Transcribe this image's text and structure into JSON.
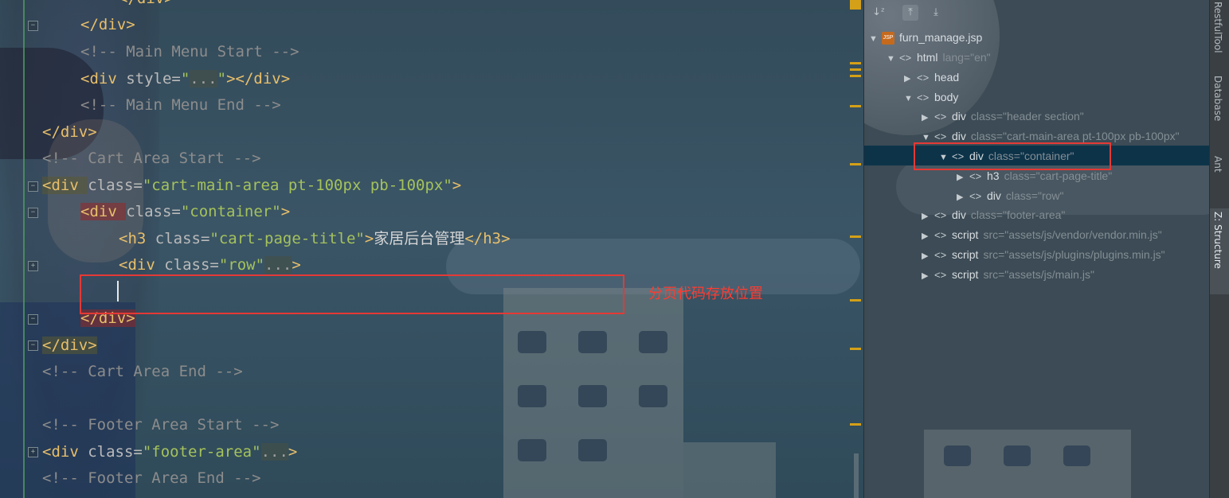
{
  "editor": {
    "lines": [
      {
        "indent": 2,
        "tag_open": "</div>"
      },
      {
        "indent": 1,
        "tag_open": "</div>"
      },
      {
        "indent": 1,
        "comment": "<!-- Main Menu Start -->"
      },
      {
        "indent": 1,
        "div_style": {
          "open": "<div ",
          "attr": "style=",
          "val": "\"",
          "fold": "...",
          "val_end": "\"",
          "close": "></div>"
        }
      },
      {
        "indent": 1,
        "comment": "<!-- Main Menu End -->"
      },
      {
        "indent": 0,
        "tag_open": "</div>"
      },
      {
        "indent": 0,
        "comment": "<!-- Cart Area Start -->"
      },
      {
        "indent": 0,
        "open": "<div ",
        "attr": "class=",
        "val": "\"cart-main-area pt-100px pb-100px\"",
        "close": ">"
      },
      {
        "indent": 1,
        "open": "<div ",
        "attr": "class=",
        "val": "\"container\"",
        "close": ">"
      },
      {
        "indent": 2,
        "open": "<h3 ",
        "attr": "class=",
        "val": "\"cart-page-title\"",
        "close": ">",
        "text": "家居后台管理",
        "end": "</h3>"
      },
      {
        "indent": 2,
        "open": "<div ",
        "attr": "class=",
        "val": "\"row\"",
        "fold": "...",
        "close": ">"
      },
      {
        "indent": 2,
        "caret": true
      },
      {
        "indent": 1,
        "tag_open": "</div>"
      },
      {
        "indent": 0,
        "tag_open": "</div>"
      },
      {
        "indent": 0,
        "comment": "<!-- Cart Area End -->"
      },
      {
        "indent": 0,
        "blank": true
      },
      {
        "indent": 0,
        "comment": "<!-- Footer Area Start -->"
      },
      {
        "indent": 0,
        "open": "<div ",
        "attr": "class=",
        "val": "\"footer-area\"",
        "fold": "...",
        "close": ">"
      },
      {
        "indent": 0,
        "comment": "<!-- Footer Area End -->"
      }
    ],
    "annotation": "分页代码存放位置"
  },
  "structure": {
    "file": "furn_manage.jsp",
    "file_badge": "JSP",
    "nodes": [
      {
        "label": "html",
        "attr": "lang=\"en\"",
        "level": 1,
        "expanded": true
      },
      {
        "label": "head",
        "attr": "",
        "level": 2,
        "expanded": false
      },
      {
        "label": "body",
        "attr": "",
        "level": 2,
        "expanded": true
      },
      {
        "label": "div",
        "attr": "class=\"header section\"",
        "level": 3,
        "expanded": false
      },
      {
        "label": "div",
        "attr": "class=\"cart-main-area pt-100px pb-100px\"",
        "level": 3,
        "expanded": true
      },
      {
        "label": "div",
        "attr": "class=\"container\"",
        "level": 4,
        "expanded": true,
        "selected": true
      },
      {
        "label": "h3",
        "attr": "class=\"cart-page-title\"",
        "level": 5,
        "expanded": false
      },
      {
        "label": "div",
        "attr": "class=\"row\"",
        "level": 5,
        "expanded": false
      },
      {
        "label": "div",
        "attr": "class=\"footer-area\"",
        "level": 3,
        "expanded": false
      },
      {
        "label": "script",
        "attr": "src=\"assets/js/vendor/vendor.min.js\"",
        "level": 3,
        "expanded": false
      },
      {
        "label": "script",
        "attr": "src=\"assets/js/plugins/plugins.min.js\"",
        "level": 3,
        "expanded": false
      },
      {
        "label": "script",
        "attr": "src=\"assets/js/main.js\"",
        "level": 3,
        "expanded": false
      }
    ],
    "toolbar": {
      "sort_icon": "sort-alpha-icon",
      "expand_icon": "expand-all-icon",
      "collapse_icon": "collapse-all-icon"
    }
  },
  "side_strip": {
    "tabs": [
      {
        "label": "RestfulTool",
        "icon": "rest-icon"
      },
      {
        "label": "Database",
        "icon": "database-icon"
      },
      {
        "label": "Ant",
        "icon": "ant-icon"
      },
      {
        "label": "Z: Structure",
        "icon": "structure-icon",
        "active": true
      }
    ]
  }
}
